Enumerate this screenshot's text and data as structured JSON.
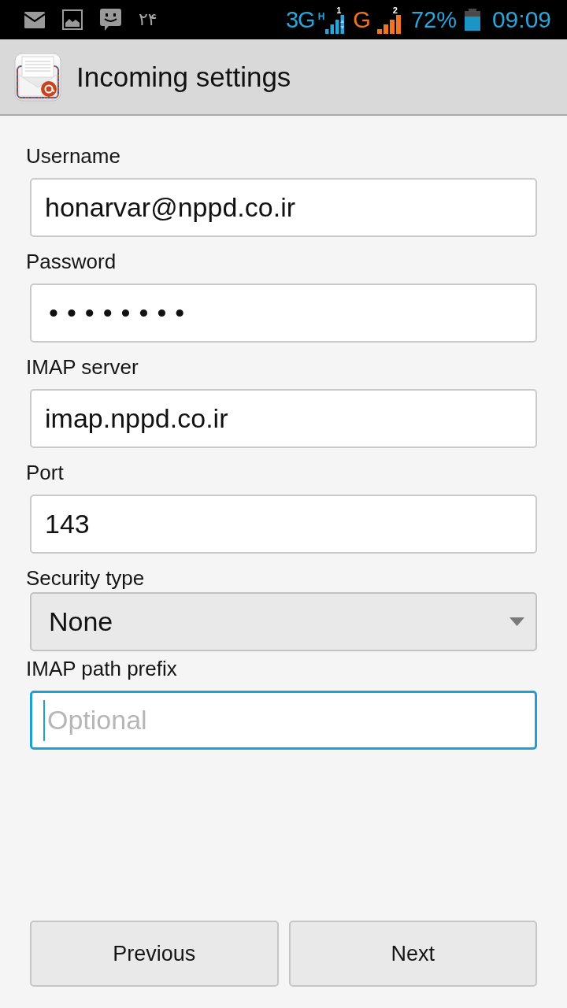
{
  "status_bar": {
    "notification_text": "۲۴",
    "sims": [
      {
        "network": "3G",
        "mode": "H",
        "slot": "1",
        "color": "#2aa5dc"
      },
      {
        "network": "G",
        "slot": "2",
        "color": "#f2741f"
      }
    ],
    "battery": "72%",
    "time": "09:09"
  },
  "header": {
    "title": "Incoming settings"
  },
  "fields": [
    {
      "label": "Username",
      "kind": "text",
      "value": "honarvar@nppd.co.ir",
      "focused": false
    },
    {
      "label": "Password",
      "kind": "password",
      "value": "••••••••",
      "focused": false
    },
    {
      "label": "IMAP server",
      "kind": "text",
      "value": "imap.nppd.co.ir",
      "focused": false
    },
    {
      "label": "Port",
      "kind": "text",
      "value": "143",
      "focused": false
    },
    {
      "label": "Security type",
      "kind": "select",
      "value": "None",
      "focused": false
    },
    {
      "label": "IMAP path prefix",
      "kind": "text",
      "placeholder": "Optional",
      "focused": true
    }
  ],
  "buttons": [
    "Previous",
    "Next"
  ]
}
